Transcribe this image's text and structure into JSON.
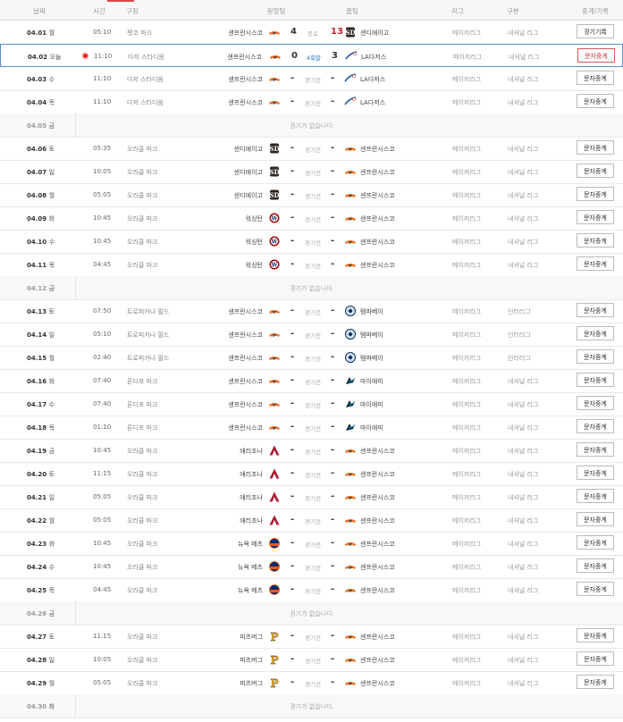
{
  "header": {
    "date": "날짜",
    "time": "시간",
    "stadium": "구장",
    "away": "원정팀",
    "home": "홈팀",
    "league": "리그",
    "kind": "구분",
    "relay": "중계/기록"
  },
  "colors": {
    "accent": "#d44444",
    "today_border": "#5b8fd6",
    "win_score": "#c62222",
    "live": "#2d78c6"
  },
  "rows": [
    {
      "date": "04.01",
      "dow": "월",
      "today": false,
      "time": "05:10",
      "stadium": "펫코 파크",
      "away": "샌프란시스코",
      "away_logo": "giants",
      "away_score": "4",
      "status": "종료",
      "home_score": "13",
      "home_logo": "padres",
      "home": "샌디에이고",
      "league": "메이저리그",
      "kind": "내셔널 리그",
      "button": "경기기록",
      "empty": false
    },
    {
      "date": "04.02",
      "dow": "오늘",
      "today": true,
      "time": "11:10",
      "stadium": "다저 스타디움",
      "away": "샌프란시스코",
      "away_logo": "giants",
      "away_score": "0",
      "status": "4회말",
      "home_score": "3",
      "home_logo": "dodgers",
      "home": "LA다저스",
      "league": "메이저리그",
      "kind": "내셔널 리그",
      "button": "문자중계",
      "empty": false
    },
    {
      "date": "04.03",
      "dow": "수",
      "today": false,
      "time": "11:10",
      "stadium": "다저 스타디움",
      "away": "샌프란시스코",
      "away_logo": "giants",
      "away_score": "-",
      "status": "경기전",
      "home_score": "-",
      "home_logo": "dodgers",
      "home": "LA다저스",
      "league": "메이저리그",
      "kind": "내셔널 리그",
      "button": "문자중계",
      "empty": false
    },
    {
      "date": "04.04",
      "dow": "목",
      "today": false,
      "time": "11:10",
      "stadium": "다저 스타디움",
      "away": "샌프란시스코",
      "away_logo": "giants",
      "away_score": "-",
      "status": "경기전",
      "home_score": "-",
      "home_logo": "dodgers",
      "home": "LA다저스",
      "league": "메이저리그",
      "kind": "내셔널 리그",
      "button": "문자중계",
      "empty": false
    },
    {
      "date": "04.05",
      "dow": "금",
      "empty": true,
      "message": "경기가 없습니다."
    },
    {
      "date": "04.06",
      "dow": "토",
      "today": false,
      "time": "05:35",
      "stadium": "오라클 파크",
      "away": "샌디에이고",
      "away_logo": "padres",
      "away_score": "-",
      "status": "경기전",
      "home_score": "-",
      "home_logo": "giants",
      "home": "샌프란시스코",
      "league": "메이저리그",
      "kind": "내셔널 리그",
      "button": "문자중계",
      "empty": false
    },
    {
      "date": "04.07",
      "dow": "일",
      "today": false,
      "time": "10:05",
      "stadium": "오라클 파크",
      "away": "샌디에이고",
      "away_logo": "padres",
      "away_score": "-",
      "status": "경기전",
      "home_score": "-",
      "home_logo": "giants",
      "home": "샌프란시스코",
      "league": "메이저리그",
      "kind": "내셔널 리그",
      "button": "문자중계",
      "empty": false
    },
    {
      "date": "04.08",
      "dow": "월",
      "today": false,
      "time": "05:05",
      "stadium": "오라클 파크",
      "away": "샌디에이고",
      "away_logo": "padres",
      "away_score": "-",
      "status": "경기전",
      "home_score": "-",
      "home_logo": "giants",
      "home": "샌프란시스코",
      "league": "메이저리그",
      "kind": "내셔널 리그",
      "button": "문자중계",
      "empty": false
    },
    {
      "date": "04.09",
      "dow": "화",
      "today": false,
      "time": "10:45",
      "stadium": "오라클 파크",
      "away": "워싱턴",
      "away_logo": "nationals",
      "away_score": "-",
      "status": "경기전",
      "home_score": "-",
      "home_logo": "giants",
      "home": "샌프란시스코",
      "league": "메이저리그",
      "kind": "내셔널 리그",
      "button": "문자중계",
      "empty": false
    },
    {
      "date": "04.10",
      "dow": "수",
      "today": false,
      "time": "10:45",
      "stadium": "오라클 파크",
      "away": "워싱턴",
      "away_logo": "nationals",
      "away_score": "-",
      "status": "경기전",
      "home_score": "-",
      "home_logo": "giants",
      "home": "샌프란시스코",
      "league": "메이저리그",
      "kind": "내셔널 리그",
      "button": "문자중계",
      "empty": false
    },
    {
      "date": "04.11",
      "dow": "목",
      "today": false,
      "time": "04:45",
      "stadium": "오라클 파크",
      "away": "워싱턴",
      "away_logo": "nationals",
      "away_score": "-",
      "status": "경기전",
      "home_score": "-",
      "home_logo": "giants",
      "home": "샌프란시스코",
      "league": "메이저리그",
      "kind": "내셔널 리그",
      "button": "문자중계",
      "empty": false
    },
    {
      "date": "04.12",
      "dow": "금",
      "empty": true,
      "message": "경기가 없습니다."
    },
    {
      "date": "04.13",
      "dow": "토",
      "today": false,
      "time": "07:50",
      "stadium": "트로피카나 필드",
      "away": "샌프란시스코",
      "away_logo": "giants",
      "away_score": "-",
      "status": "경기전",
      "home_score": "-",
      "home_logo": "rays",
      "home": "탬파베이",
      "league": "메이저리그",
      "kind": "인터리그",
      "button": "문자중계",
      "empty": false
    },
    {
      "date": "04.14",
      "dow": "일",
      "today": false,
      "time": "05:10",
      "stadium": "트로피카나 필드",
      "away": "샌프란시스코",
      "away_logo": "giants",
      "away_score": "-",
      "status": "경기전",
      "home_score": "-",
      "home_logo": "rays",
      "home": "탬파베이",
      "league": "메이저리그",
      "kind": "인터리그",
      "button": "문자중계",
      "empty": false
    },
    {
      "date": "04.15",
      "dow": "월",
      "today": false,
      "time": "02:40",
      "stadium": "트로피카나 필드",
      "away": "샌프란시스코",
      "away_logo": "giants",
      "away_score": "-",
      "status": "경기전",
      "home_score": "-",
      "home_logo": "rays",
      "home": "탬파베이",
      "league": "메이저리그",
      "kind": "인터리그",
      "button": "문자중계",
      "empty": false
    },
    {
      "date": "04.16",
      "dow": "화",
      "today": false,
      "time": "07:40",
      "stadium": "론디포 파크",
      "away": "샌프란시스코",
      "away_logo": "giants",
      "away_score": "-",
      "status": "경기전",
      "home_score": "-",
      "home_logo": "marlins",
      "home": "마이애미",
      "league": "메이저리그",
      "kind": "내셔널 리그",
      "button": "문자중계",
      "empty": false
    },
    {
      "date": "04.17",
      "dow": "수",
      "today": false,
      "time": "07:40",
      "stadium": "론디포 파크",
      "away": "샌프란시스코",
      "away_logo": "giants",
      "away_score": "-",
      "status": "경기전",
      "home_score": "-",
      "home_logo": "marlins",
      "home": "마이애미",
      "league": "메이저리그",
      "kind": "내셔널 리그",
      "button": "문자중계",
      "empty": false
    },
    {
      "date": "04.18",
      "dow": "목",
      "today": false,
      "time": "01:10",
      "stadium": "론디포 파크",
      "away": "샌프란시스코",
      "away_logo": "giants",
      "away_score": "-",
      "status": "경기전",
      "home_score": "-",
      "home_logo": "marlins",
      "home": "마이애미",
      "league": "메이저리그",
      "kind": "내셔널 리그",
      "button": "문자중계",
      "empty": false
    },
    {
      "date": "04.19",
      "dow": "금",
      "today": false,
      "time": "10:45",
      "stadium": "오라클 파크",
      "away": "애리조나",
      "away_logo": "dbacks",
      "away_score": "-",
      "status": "경기전",
      "home_score": "-",
      "home_logo": "giants",
      "home": "샌프란시스코",
      "league": "메이저리그",
      "kind": "내셔널 리그",
      "button": "문자중계",
      "empty": false
    },
    {
      "date": "04.20",
      "dow": "토",
      "today": false,
      "time": "11:15",
      "stadium": "오라클 파크",
      "away": "애리조나",
      "away_logo": "dbacks",
      "away_score": "-",
      "status": "경기전",
      "home_score": "-",
      "home_logo": "giants",
      "home": "샌프란시스코",
      "league": "메이저리그",
      "kind": "내셔널 리그",
      "button": "문자중계",
      "empty": false
    },
    {
      "date": "04.21",
      "dow": "일",
      "today": false,
      "time": "05:05",
      "stadium": "오라클 파크",
      "away": "애리조나",
      "away_logo": "dbacks",
      "away_score": "-",
      "status": "경기전",
      "home_score": "-",
      "home_logo": "giants",
      "home": "샌프란시스코",
      "league": "메이저리그",
      "kind": "내셔널 리그",
      "button": "문자중계",
      "empty": false
    },
    {
      "date": "04.22",
      "dow": "월",
      "today": false,
      "time": "05:05",
      "stadium": "오라클 파크",
      "away": "애리조나",
      "away_logo": "dbacks",
      "away_score": "-",
      "status": "경기전",
      "home_score": "-",
      "home_logo": "giants",
      "home": "샌프란시스코",
      "league": "메이저리그",
      "kind": "내셔널 리그",
      "button": "문자중계",
      "empty": false
    },
    {
      "date": "04.23",
      "dow": "화",
      "today": false,
      "time": "10:45",
      "stadium": "오라클 파크",
      "away": "뉴욕 메츠",
      "away_logo": "mets",
      "away_score": "-",
      "status": "경기전",
      "home_score": "-",
      "home_logo": "giants",
      "home": "샌프란시스코",
      "league": "메이저리그",
      "kind": "내셔널 리그",
      "button": "문자중계",
      "empty": false
    },
    {
      "date": "04.24",
      "dow": "수",
      "today": false,
      "time": "10:45",
      "stadium": "오라클 파크",
      "away": "뉴욕 메츠",
      "away_logo": "mets",
      "away_score": "-",
      "status": "경기전",
      "home_score": "-",
      "home_logo": "giants",
      "home": "샌프란시스코",
      "league": "메이저리그",
      "kind": "내셔널 리그",
      "button": "문자중계",
      "empty": false
    },
    {
      "date": "04.25",
      "dow": "목",
      "today": false,
      "time": "04:45",
      "stadium": "오라클 파크",
      "away": "뉴욕 메츠",
      "away_logo": "mets",
      "away_score": "-",
      "status": "경기전",
      "home_score": "-",
      "home_logo": "giants",
      "home": "샌프란시스코",
      "league": "메이저리그",
      "kind": "내셔널 리그",
      "button": "문자중계",
      "empty": false
    },
    {
      "date": "04.26",
      "dow": "금",
      "empty": true,
      "message": "경기가 없습니다."
    },
    {
      "date": "04.27",
      "dow": "토",
      "today": false,
      "time": "11:15",
      "stadium": "오라클 파크",
      "away": "피츠버그",
      "away_logo": "pirates",
      "away_score": "-",
      "status": "경기전",
      "home_score": "-",
      "home_logo": "giants",
      "home": "샌프란시스코",
      "league": "메이저리그",
      "kind": "내셔널 리그",
      "button": "문자중계",
      "empty": false
    },
    {
      "date": "04.28",
      "dow": "일",
      "today": false,
      "time": "10:05",
      "stadium": "오라클 파크",
      "away": "피츠버그",
      "away_logo": "pirates",
      "away_score": "-",
      "status": "경기전",
      "home_score": "-",
      "home_logo": "giants",
      "home": "샌프란시스코",
      "league": "메이저리그",
      "kind": "내셔널 리그",
      "button": "문자중계",
      "empty": false
    },
    {
      "date": "04.29",
      "dow": "월",
      "today": false,
      "time": "05:05",
      "stadium": "오라클 파크",
      "away": "피츠버그",
      "away_logo": "pirates",
      "away_score": "-",
      "status": "경기전",
      "home_score": "-",
      "home_logo": "giants",
      "home": "샌프란시스코",
      "league": "메이저리그",
      "kind": "내셔널 리그",
      "button": "문자중계",
      "empty": false
    },
    {
      "date": "04.30",
      "dow": "화",
      "empty": true,
      "message": "경기가 없습니다."
    }
  ]
}
